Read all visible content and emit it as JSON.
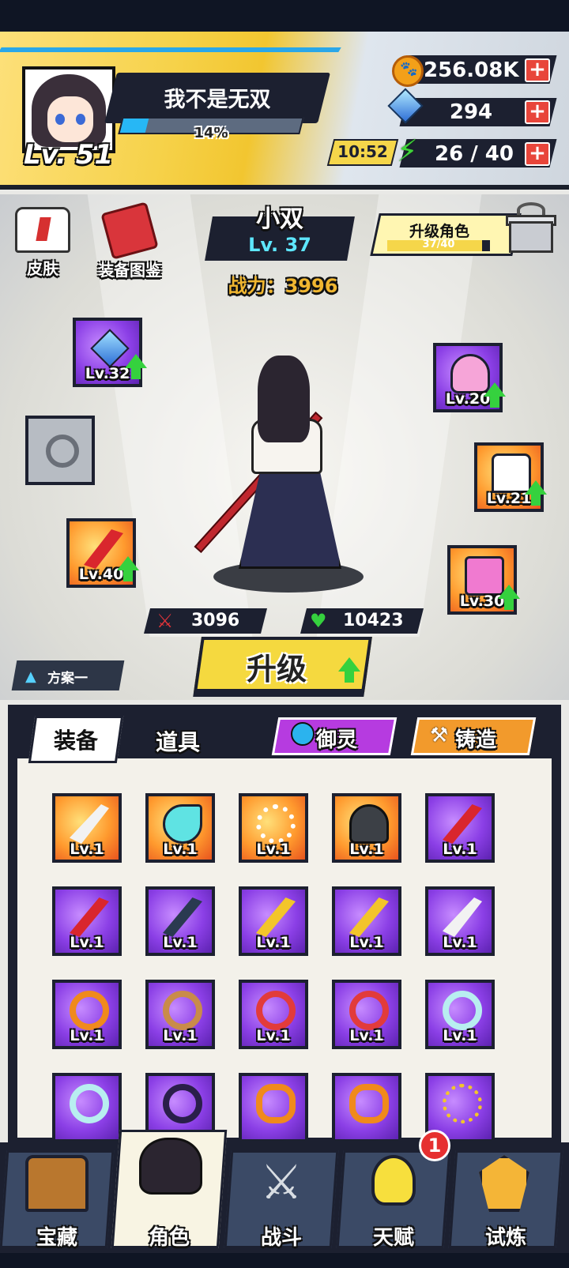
{
  "player": {
    "name": "我不是无双",
    "level": "Lv. 51",
    "exp_percent": "14%",
    "exp_fraction": 0.14
  },
  "resources": {
    "coins": "256.08K",
    "gems": "294",
    "energy": "26 / 40",
    "energy_timer": "10:52",
    "add_label": "+"
  },
  "side_buttons": {
    "skin": "皮肤",
    "catalog": "装备图鉴"
  },
  "character": {
    "name": "小双",
    "level": "Lv. 37",
    "power": "战力：3996",
    "attack": "3096",
    "hp": "10423"
  },
  "upgrade_character": {
    "label": "升级角色",
    "progress": "37/40",
    "progress_fraction": 0.925
  },
  "equipped": {
    "amulet": "Lv.32",
    "ring": "",
    "weapon": "Lv.40",
    "helmet": "Lv.20",
    "armor": "Lv.21",
    "boots": "Lv.30"
  },
  "upgrade_button": "升级",
  "plan_label": "方案一",
  "inventory": {
    "tab_equipment": "装备",
    "tab_items": "道具",
    "spirit_button": "御灵",
    "forge_button": "铸造",
    "items": [
      {
        "rarity": "orange",
        "icon": "scimitar",
        "level": "Lv.1"
      },
      {
        "rarity": "orange",
        "icon": "necklace",
        "level": "Lv.1"
      },
      {
        "rarity": "orange",
        "icon": "beads",
        "level": "Lv.1"
      },
      {
        "rarity": "orange",
        "icon": "helmet",
        "level": "Lv.1"
      },
      {
        "rarity": "purple",
        "icon": "red-blade",
        "level": "Lv.1"
      },
      {
        "rarity": "purple",
        "icon": "red-blade",
        "level": "Lv.1"
      },
      {
        "rarity": "purple",
        "icon": "dark-blade",
        "level": "Lv.1"
      },
      {
        "rarity": "purple",
        "icon": "gold-blade",
        "level": "Lv.1"
      },
      {
        "rarity": "purple",
        "icon": "gold-blade",
        "level": "Lv.1"
      },
      {
        "rarity": "purple",
        "icon": "scimitar",
        "level": "Lv.1"
      },
      {
        "rarity": "purple",
        "icon": "orange-ring",
        "level": "Lv.1"
      },
      {
        "rarity": "purple",
        "icon": "bronze-ring",
        "level": "Lv.1"
      },
      {
        "rarity": "purple",
        "icon": "red-ring",
        "level": "Lv.1"
      },
      {
        "rarity": "purple",
        "icon": "red-ring",
        "level": "Lv.1"
      },
      {
        "rarity": "purple",
        "icon": "moon-ring",
        "level": "Lv.1"
      },
      {
        "rarity": "purple",
        "icon": "moon-ring",
        "level": ""
      },
      {
        "rarity": "purple",
        "icon": "dark-ring",
        "level": ""
      },
      {
        "rarity": "purple",
        "icon": "dragon-ring",
        "level": ""
      },
      {
        "rarity": "purple",
        "icon": "dragon-ring",
        "level": ""
      },
      {
        "rarity": "purple",
        "icon": "gem-necklace",
        "level": ""
      }
    ]
  },
  "nav": {
    "treasure": "宝藏",
    "character": "角色",
    "battle": "战斗",
    "talent": "天赋",
    "trial": "试炼",
    "talent_badge": "1"
  },
  "colors": {
    "accent_yellow": "#f5d93f",
    "panel_dark": "#1c2030",
    "epic_purple": "#8b3fe6",
    "legend_orange": "#ff9a2e",
    "upgrade_green": "#35d13e"
  }
}
